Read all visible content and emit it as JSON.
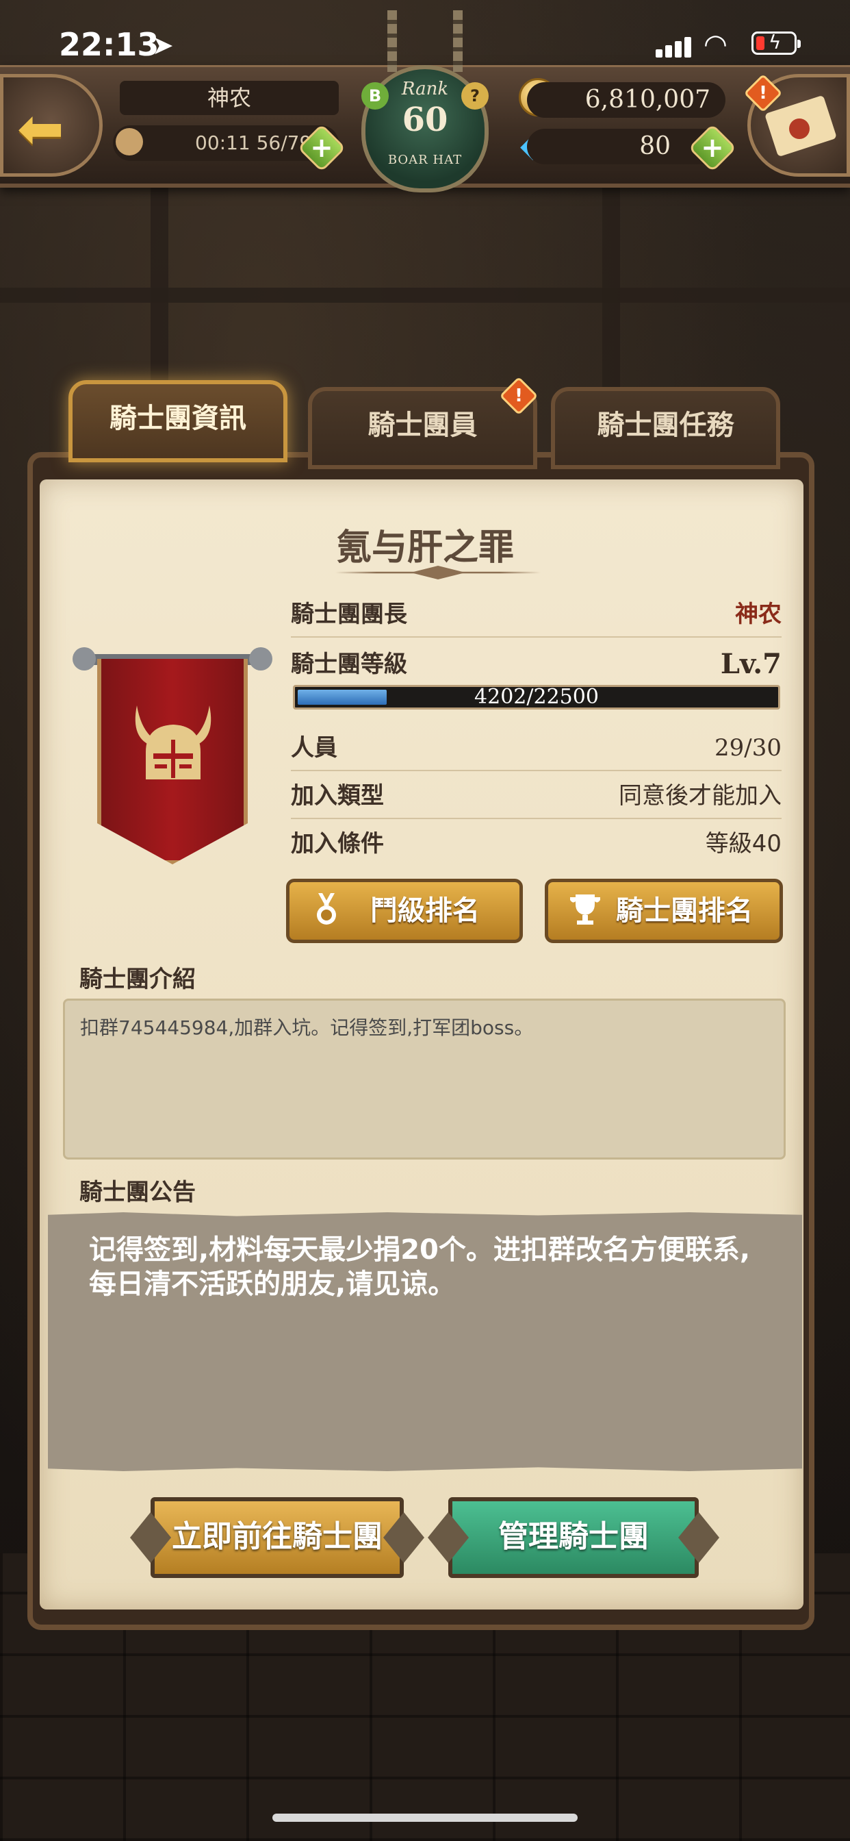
{
  "status_bar": {
    "time": "22:13"
  },
  "hud": {
    "player_name": "神农",
    "stamina": "00:11 56/79",
    "rank_title": "Rank",
    "rank_level": "60",
    "rank_sub": "BOAR HAT",
    "rank_badge_left": "B",
    "rank_badge_right": "?",
    "gold": "6,810,007",
    "gems": "80"
  },
  "tabs": [
    {
      "label": "騎士團資訊",
      "active": true
    },
    {
      "label": "騎士團員",
      "alert": true
    },
    {
      "label": "騎士團任務"
    }
  ],
  "guild": {
    "name": "氪与肝之罪",
    "leader_label": "騎士團團長",
    "leader_value": "神农",
    "level_label": "騎士團等級",
    "level_value": "Lv.7",
    "xp_text": "4202/22500",
    "xp_current": 4202,
    "xp_max": 22500,
    "members_label": "人員",
    "members_value": "29/30",
    "join_type_label": "加入類型",
    "join_type_value": "同意後才能加入",
    "join_req_label": "加入條件",
    "join_req_value": "等級40"
  },
  "buttons": {
    "fight_rank": "鬥級排名",
    "guild_rank": "騎士團排名",
    "go_to_guild": "立即前往騎士團",
    "manage_guild": "管理騎士團"
  },
  "intro": {
    "title": "騎士團介紹",
    "text": "扣群745445984,加群入坑。记得签到,打军团boss。"
  },
  "notice": {
    "title": "騎士團公告",
    "text": "记得签到,材料每天最少捐20个。进扣群改名方便联系,每日清不活跃的朋友,请见谅。"
  },
  "colors": {
    "active_tab_glow": "#c9963f",
    "banner_red": "#a5191c",
    "gold_button": "#e6b24a",
    "green_button": "#4cbf92",
    "xp_fill": "#2e6db6"
  }
}
